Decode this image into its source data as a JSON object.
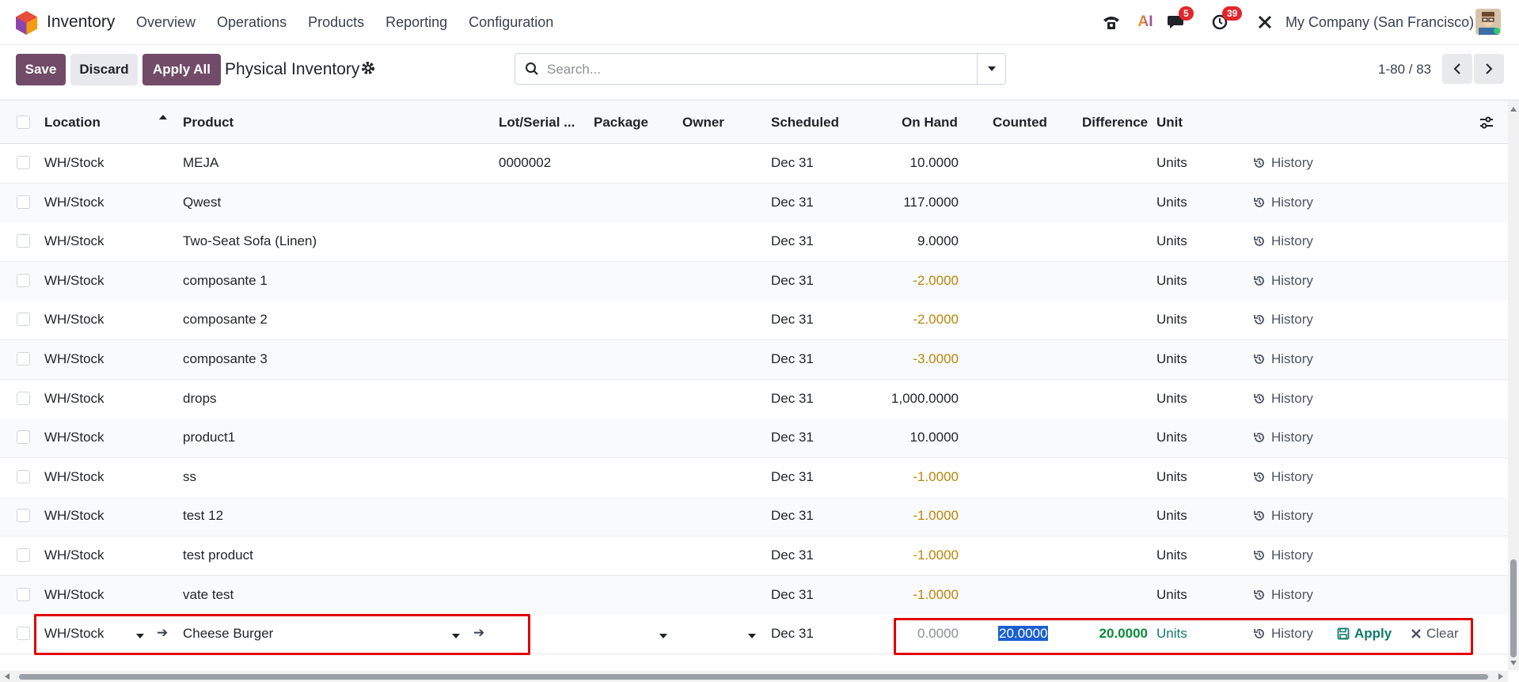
{
  "nav": {
    "app_name": "Inventory",
    "menu": [
      "Overview",
      "Operations",
      "Products",
      "Reporting",
      "Configuration"
    ],
    "chat_badge": "5",
    "activity_badge": "39",
    "ai_label": "AI",
    "company": "My Company (San Francisco)"
  },
  "control": {
    "save": "Save",
    "discard": "Discard",
    "apply_all": "Apply All",
    "title": "Physical Inventory",
    "search_placeholder": "Search...",
    "pager": "1-80 / 83"
  },
  "columns": {
    "location": "Location",
    "product": "Product",
    "lot": "Lot/Serial ...",
    "package": "Package",
    "owner": "Owner",
    "scheduled": "Scheduled",
    "on_hand": "On Hand",
    "counted": "Counted",
    "difference": "Difference",
    "unit": "Unit"
  },
  "history_label": "History",
  "rows": [
    {
      "location": "WH/Stock",
      "product": "MEJA",
      "lot": "0000002",
      "scheduled": "Dec 31",
      "on_hand": "10.0000",
      "negative": false,
      "unit": "Units"
    },
    {
      "location": "WH/Stock",
      "product": "Qwest",
      "lot": "",
      "scheduled": "Dec 31",
      "on_hand": "117.0000",
      "negative": false,
      "unit": "Units"
    },
    {
      "location": "WH/Stock",
      "product": "Two-Seat Sofa (Linen)",
      "lot": "",
      "scheduled": "Dec 31",
      "on_hand": "9.0000",
      "negative": false,
      "unit": "Units"
    },
    {
      "location": "WH/Stock",
      "product": "composante 1",
      "lot": "",
      "scheduled": "Dec 31",
      "on_hand": "-2.0000",
      "negative": true,
      "unit": "Units"
    },
    {
      "location": "WH/Stock",
      "product": "composante 2",
      "lot": "",
      "scheduled": "Dec 31",
      "on_hand": "-2.0000",
      "negative": true,
      "unit": "Units"
    },
    {
      "location": "WH/Stock",
      "product": "composante 3",
      "lot": "",
      "scheduled": "Dec 31",
      "on_hand": "-3.0000",
      "negative": true,
      "unit": "Units"
    },
    {
      "location": "WH/Stock",
      "product": "drops",
      "lot": "",
      "scheduled": "Dec 31",
      "on_hand": "1,000.0000",
      "negative": false,
      "unit": "Units"
    },
    {
      "location": "WH/Stock",
      "product": "product1",
      "lot": "",
      "scheduled": "Dec 31",
      "on_hand": "10.0000",
      "negative": false,
      "unit": "Units"
    },
    {
      "location": "WH/Stock",
      "product": "ss",
      "lot": "",
      "scheduled": "Dec 31",
      "on_hand": "-1.0000",
      "negative": true,
      "unit": "Units"
    },
    {
      "location": "WH/Stock",
      "product": "test 12",
      "lot": "",
      "scheduled": "Dec 31",
      "on_hand": "-1.0000",
      "negative": true,
      "unit": "Units"
    },
    {
      "location": "WH/Stock",
      "product": "test product",
      "lot": "",
      "scheduled": "Dec 31",
      "on_hand": "-1.0000",
      "negative": true,
      "unit": "Units"
    },
    {
      "location": "WH/Stock",
      "product": "vate test",
      "lot": "",
      "scheduled": "Dec 31",
      "on_hand": "-1.0000",
      "negative": true,
      "unit": "Units"
    }
  ],
  "edit_row": {
    "location": "WH/Stock",
    "product": "Cheese Burger",
    "scheduled": "Dec 31",
    "on_hand": "0.0000",
    "counted": "20.0000",
    "difference": "20.0000",
    "unit": "Units",
    "apply": "Apply",
    "clear": "Clear"
  },
  "colors": {
    "primary": "#714b67",
    "negative": "#b8860b",
    "positive": "#0a8a3a",
    "highlight_box": "#e00000"
  }
}
